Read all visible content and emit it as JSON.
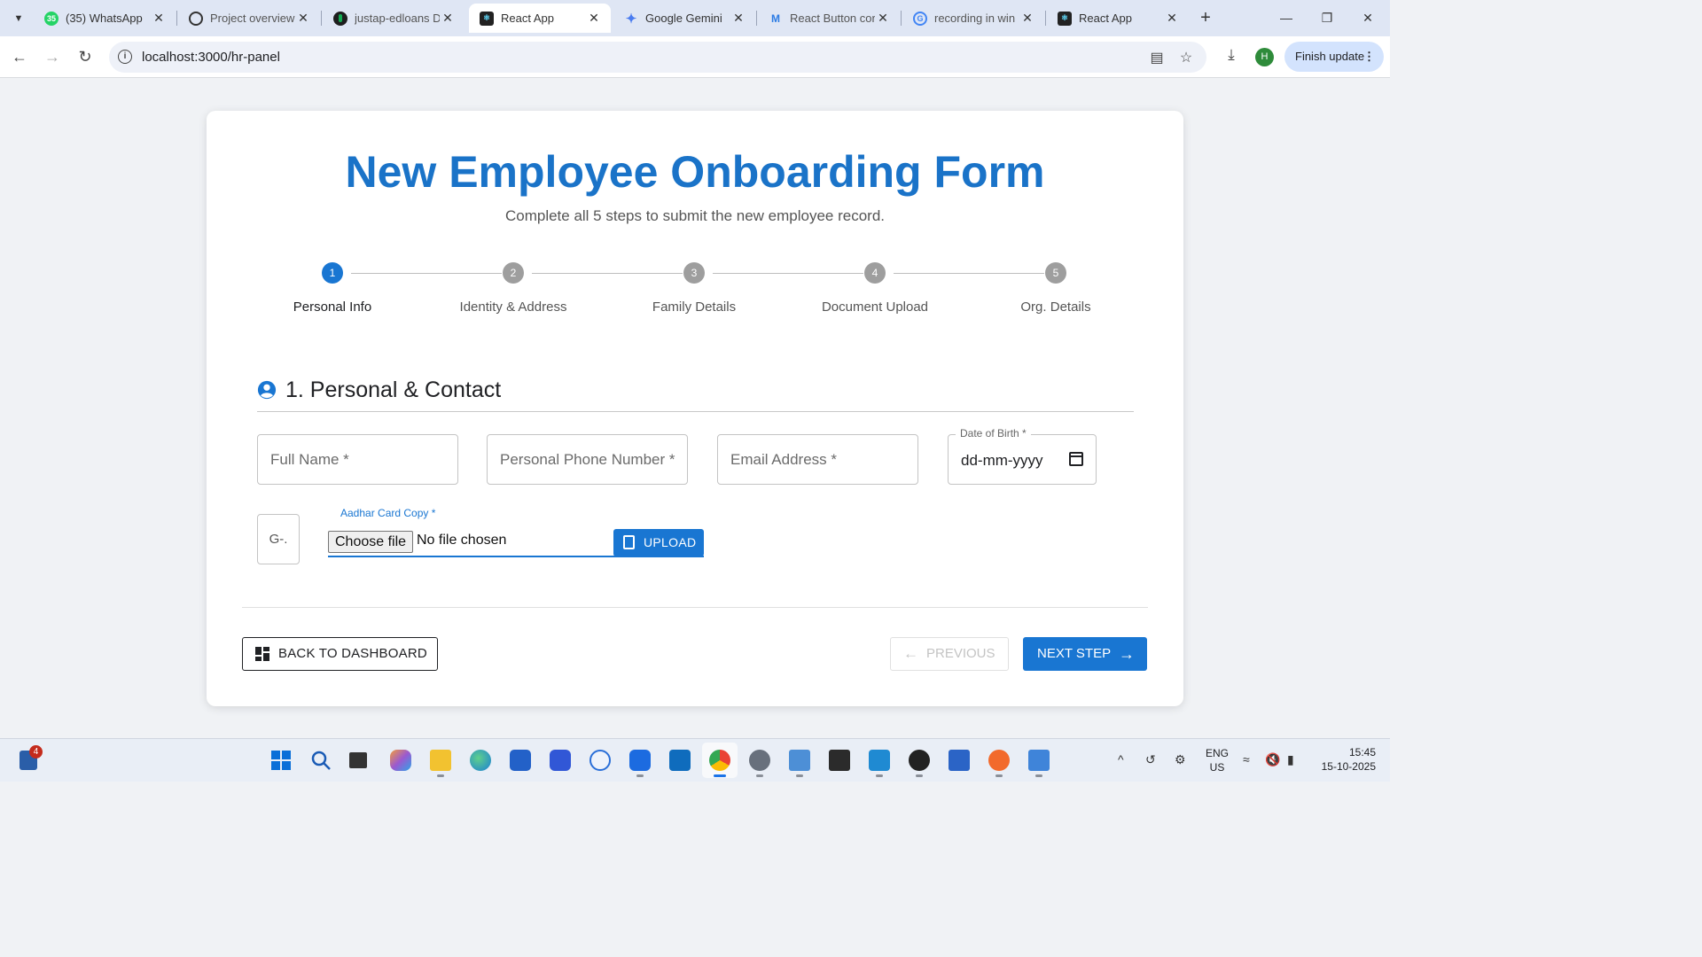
{
  "browser": {
    "tabs": [
      {
        "title": "(35) WhatsApp",
        "favicon": "whatsapp-icon",
        "color": "#25d366",
        "badge": "35"
      },
      {
        "title": "Project overview",
        "favicon": "openai-icon",
        "color": "#333333",
        "badge": ""
      },
      {
        "title": "justap-edloans D",
        "favicon": "mongodb-icon",
        "color": "#1e1e1e",
        "badge": ""
      },
      {
        "title": "React App",
        "favicon": "react-icon",
        "color": "#222222",
        "badge": "",
        "active": true
      },
      {
        "title": "Google Gemini",
        "favicon": "gemini-icon",
        "color": "#4a7cf0",
        "badge": ""
      },
      {
        "title": "React Button cor",
        "favicon": "mui-icon",
        "color": "#2b7be4",
        "badge": ""
      },
      {
        "title": "recording in win",
        "favicon": "google-icon",
        "color": "#ffffff",
        "badge": ""
      },
      {
        "title": "React App",
        "favicon": "react-icon",
        "color": "#222222",
        "badge": ""
      }
    ],
    "url": "localhost:3000/hr-panel",
    "profile_initial": "H",
    "finish_update_label": "Finish update"
  },
  "form": {
    "title": "New Employee Onboarding Form",
    "subtitle": "Complete all 5 steps to submit the new employee record.",
    "steps": [
      {
        "number": "1",
        "label": "Personal Info",
        "active": true
      },
      {
        "number": "2",
        "label": "Identity & Address",
        "active": false
      },
      {
        "number": "3",
        "label": "Family Details",
        "active": false
      },
      {
        "number": "4",
        "label": "Document Upload",
        "active": false
      },
      {
        "number": "5",
        "label": "Org. Details",
        "active": false
      }
    ],
    "section_title": "1. Personal & Contact",
    "fields": {
      "full_name_placeholder": "Full Name *",
      "phone_placeholder": "Personal Phone Number *",
      "email_placeholder": "Email Address *",
      "dob_label": "Date of Birth *",
      "dob_value": "dd-mm-yyyy"
    },
    "key_box_text": "G-.",
    "aadhar_label": "Aadhar Card Copy *",
    "choose_file_label": "Choose file",
    "no_file_text": "No file chosen",
    "upload_label": "UPLOAD",
    "back_label": "BACK TO DASHBOARD",
    "previous_label": "PREVIOUS",
    "next_label": "NEXT STEP",
    "accent_color": "#1976d2"
  },
  "taskbar": {
    "notification_badge": "4",
    "language": "ENG",
    "region": "US",
    "time": "15:45",
    "date": "15-10-2025"
  }
}
